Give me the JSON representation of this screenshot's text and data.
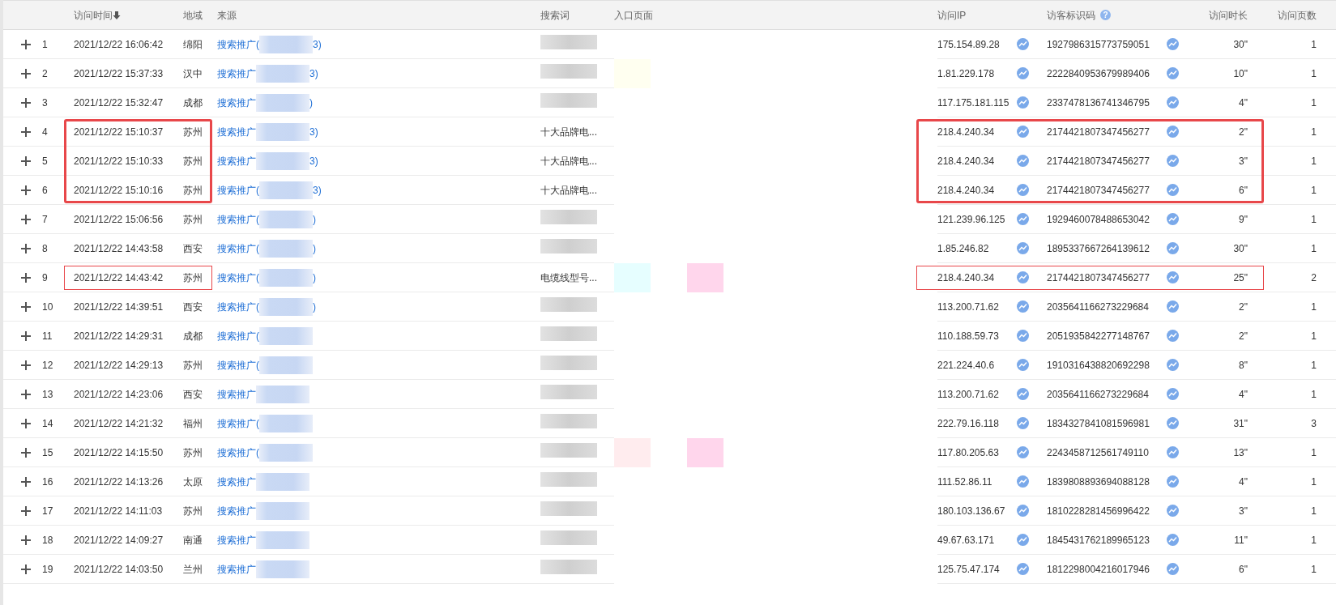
{
  "columns": [
    {
      "label": "访问时间",
      "sorted_descending": true
    },
    {
      "label": "地域"
    },
    {
      "label": "来源"
    },
    {
      "label": "搜索词"
    },
    {
      "label": "入口页面"
    },
    {
      "label": "访问IP"
    },
    {
      "label": "访客标识码",
      "help": "?"
    },
    {
      "label": "访问时长"
    },
    {
      "label": "访问页数"
    }
  ],
  "rows": [
    {
      "index": "1",
      "time": "2021/12/22 16:06:42",
      "region": "绵阳",
      "source": "搜索推广(",
      "source_tail": "3)",
      "ip": "175.154.89.28",
      "visitor_id": "1927986315773759051",
      "duration": "30\"",
      "pages": "1"
    },
    {
      "index": "2",
      "time": "2021/12/22 15:37:33",
      "region": "汉中",
      "source": "搜索推广",
      "source_tail": "3)",
      "ip": "1.81.229.178",
      "visitor_id": "2222840953679989406",
      "duration": "10\"",
      "pages": "1",
      "entry_blocks": [
        {
          "color": "#fffff0"
        }
      ]
    },
    {
      "index": "3",
      "time": "2021/12/22 15:32:47",
      "region": "成都",
      "source": "搜索推广",
      "source_tail": ")",
      "ip": "117.175.181.115",
      "visitor_id": "2337478136741346795",
      "duration": "4\"",
      "pages": "1"
    },
    {
      "index": "4",
      "time": "2021/12/22 15:10:37",
      "region": "苏州",
      "source": "搜索推广",
      "source_tail": "3)",
      "search": "十大品牌电...",
      "ip": "218.4.240.34",
      "visitor_id": "2174421807347456277",
      "duration": "2\"",
      "pages": "1",
      "highlighted": true,
      "emphasized": true
    },
    {
      "index": "5",
      "time": "2021/12/22 15:10:33",
      "region": "苏州",
      "source": "搜索推广",
      "source_tail": "3)",
      "search": "十大品牌电...",
      "ip": "218.4.240.34",
      "visitor_id": "2174421807347456277",
      "duration": "3\"",
      "pages": "1",
      "highlighted": true,
      "emphasized": true
    },
    {
      "index": "6",
      "time": "2021/12/22 15:10:16",
      "region": "苏州",
      "source": "搜索推广(",
      "source_tail": "3)",
      "search": "十大品牌电...",
      "ip": "218.4.240.34",
      "visitor_id": "2174421807347456277",
      "duration": "6\"",
      "pages": "1",
      "highlighted": true,
      "emphasized": true
    },
    {
      "index": "7",
      "time": "2021/12/22 15:06:56",
      "region": "苏州",
      "source": "搜索推广(",
      "source_tail": ")",
      "ip": "121.239.96.125",
      "visitor_id": "1929460078488653042",
      "duration": "9\"",
      "pages": "1"
    },
    {
      "index": "8",
      "time": "2021/12/22 14:43:58",
      "region": "西安",
      "source": "搜索推广(",
      "source_tail": ")",
      "ip": "1.85.246.82",
      "visitor_id": "1895337667264139612",
      "duration": "30\"",
      "pages": "1"
    },
    {
      "index": "9",
      "time": "2021/12/22 14:43:42",
      "region": "苏州",
      "source": "搜索推广(",
      "source_tail": ")",
      "search": "电缆线型号...",
      "ip": "218.4.240.34",
      "visitor_id": "2174421807347456277",
      "duration": "25\"",
      "pages": "2",
      "highlighted": true,
      "emphasized": false,
      "entry_blocks": [
        {
          "color": "#e6feff"
        },
        {
          "color": "#ffd6ec"
        }
      ]
    },
    {
      "index": "10",
      "time": "2021/12/22 14:39:51",
      "region": "西安",
      "source": "搜索推广(",
      "source_tail": ")",
      "ip": "113.200.71.62",
      "visitor_id": "2035641166273229684",
      "duration": "2\"",
      "pages": "1"
    },
    {
      "index": "11",
      "time": "2021/12/22 14:29:31",
      "region": "成都",
      "source": "搜索推广(",
      "ip": "110.188.59.73",
      "visitor_id": "2051935842277148767",
      "duration": "2\"",
      "pages": "1"
    },
    {
      "index": "12",
      "time": "2021/12/22 14:29:13",
      "region": "苏州",
      "source": "搜索推广(",
      "ip": "221.224.40.6",
      "visitor_id": "1910316438820692298",
      "duration": "8\"",
      "pages": "1"
    },
    {
      "index": "13",
      "time": "2021/12/22 14:23:06",
      "region": "西安",
      "source": "搜索推广",
      "ip": "113.200.71.62",
      "visitor_id": "2035641166273229684",
      "duration": "4\"",
      "pages": "1"
    },
    {
      "index": "14",
      "time": "2021/12/22 14:21:32",
      "region": "福州",
      "source": "搜索推广(",
      "ip": "222.79.16.118",
      "visitor_id": "1834327841081596981",
      "duration": "31\"",
      "pages": "3"
    },
    {
      "index": "15",
      "time": "2021/12/22 14:15:50",
      "region": "苏州",
      "source": "搜索推广(",
      "ip": "117.80.205.63",
      "visitor_id": "2243458712561749110",
      "duration": "13\"",
      "pages": "1",
      "entry_blocks": [
        {
          "color": "#ffecee"
        },
        {
          "color": "#ffd6ec"
        }
      ]
    },
    {
      "index": "16",
      "time": "2021/12/22 14:13:26",
      "region": "太原",
      "source": "搜索推广",
      "ip": "111.52.86.11",
      "visitor_id": "1839808893694088128",
      "duration": "4\"",
      "pages": "1"
    },
    {
      "index": "17",
      "time": "2021/12/22 14:11:03",
      "region": "苏州",
      "source": "搜索推广",
      "ip": "180.103.136.67",
      "visitor_id": "1810228281456996422",
      "duration": "3\"",
      "pages": "1"
    },
    {
      "index": "18",
      "time": "2021/12/22 14:09:27",
      "region": "南通",
      "source": "搜索推广",
      "ip": "49.67.63.171",
      "visitor_id": "1845431762189965123",
      "duration": "11\"",
      "pages": "1"
    },
    {
      "index": "19",
      "time": "2021/12/22 14:03:50",
      "region": "兰州",
      "source": "搜索推广",
      "ip": "125.75.47.174",
      "visitor_id": "1812298004216017946",
      "duration": "6\"",
      "pages": "1"
    }
  ]
}
